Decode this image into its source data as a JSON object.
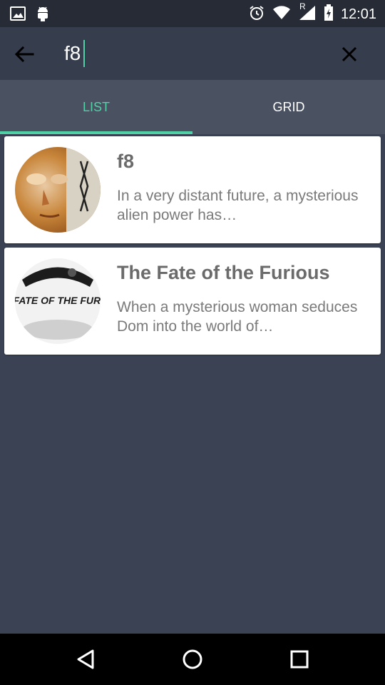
{
  "status_bar": {
    "time": "12:01",
    "icons": [
      "image-icon",
      "android-icon",
      "alarm-icon",
      "wifi-icon",
      "signal-icon",
      "battery-charging-icon"
    ],
    "network_label": "R"
  },
  "search": {
    "query": "f8",
    "accent_color": "#4fd1a5"
  },
  "tabs": [
    {
      "label": "LIST",
      "active": true
    },
    {
      "label": "GRID",
      "active": false
    }
  ],
  "results": [
    {
      "title": "f8",
      "description": "In a very distant future, a mysterious alien power has…"
    },
    {
      "title": "The Fate of the Furious",
      "description": "When a mysterious woman seduces Dom into the world of…",
      "poster_text": "THE FATE OF THE FURIOUS"
    }
  ],
  "nav_bar": {
    "buttons": [
      "back-triangle-icon",
      "home-circle-icon",
      "recents-square-icon"
    ]
  }
}
